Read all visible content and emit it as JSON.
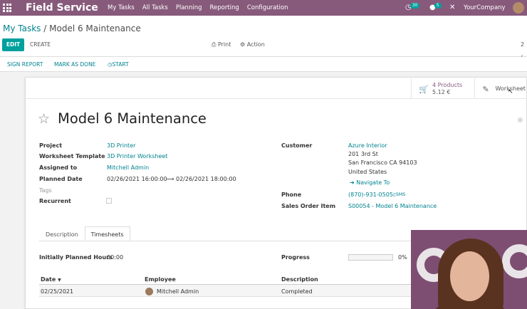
{
  "nav": {
    "app_title": "Field Service",
    "menu": [
      "My Tasks",
      "All Tasks",
      "Planning",
      "Reporting",
      "Configuration"
    ],
    "activity_count": "30",
    "message_count": "5",
    "company": "YourCompany"
  },
  "breadcrumb": {
    "parent": "My Tasks",
    "separator": "/",
    "current": "Model 6 Maintenance"
  },
  "toolbar": {
    "edit": "EDIT",
    "create": "CREATE",
    "print": "Print",
    "action": "Action",
    "pager": "2 /"
  },
  "statusbar": {
    "sign_report": "SIGN REPORT",
    "mark_as_done": "MARK AS DONE",
    "start": "START"
  },
  "smart_buttons": {
    "products_label": "4 Products",
    "products_value": "5.12 €",
    "worksheet_label": "Worksheet"
  },
  "record": {
    "title": "Model 6 Maintenance",
    "left": {
      "project_label": "Project",
      "project": "3D Printer",
      "worksheet_template_label": "Worksheet Template",
      "worksheet_template": "3D Printer Worksheet",
      "assigned_to_label": "Assigned to",
      "assigned_to": "Mitchell Admin",
      "planned_date_label": "Planned Date",
      "planned_start": "02/26/2021 16:00:00",
      "planned_end": "02/26/2021 18:00:00",
      "tags_label": "Tags",
      "recurrent_label": "Recurrent"
    },
    "right": {
      "customer_label": "Customer",
      "customer_name": "Azure Interior",
      "address_line1": "201 3rd St",
      "address_line2": "San Francisco CA 94103",
      "address_line3": "United States",
      "navigate": "Navigate To",
      "phone_label": "Phone",
      "phone": "(870)-931-0505",
      "sms": "SMS",
      "sales_order_label": "Sales Order Item",
      "sales_order": "S00054 - Model 6 Maintenance"
    }
  },
  "tabs": [
    "Description",
    "Timesheets"
  ],
  "timesheets": {
    "planned_hours_label": "Initially Planned Hours",
    "planned_hours": "00:00",
    "progress_label": "Progress",
    "progress_value": "0%",
    "progress_fraction": 0,
    "columns": [
      "Date",
      "Employee",
      "Description"
    ],
    "rows": [
      {
        "date": "02/25/2021",
        "employee": "Mitchell Admin",
        "description": "Completed"
      }
    ]
  }
}
